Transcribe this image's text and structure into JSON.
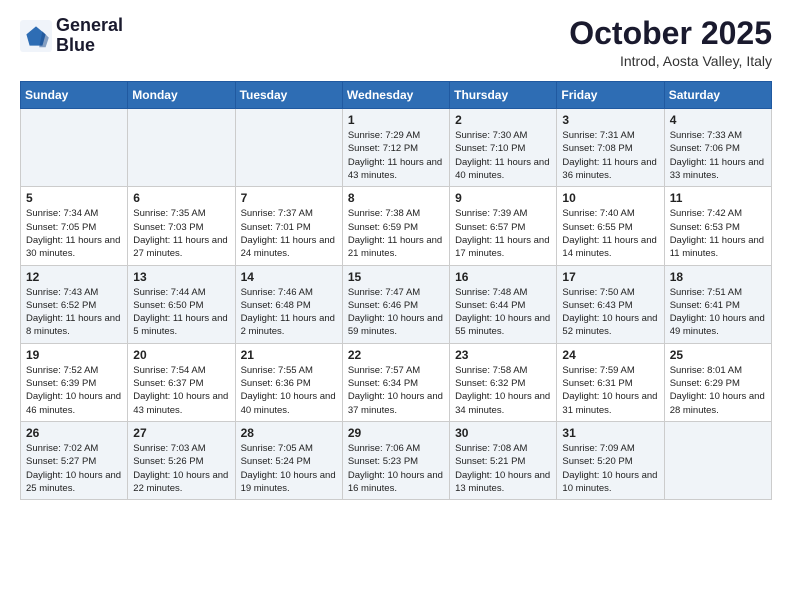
{
  "logo": {
    "line1": "General",
    "line2": "Blue"
  },
  "title": "October 2025",
  "location": "Introd, Aosta Valley, Italy",
  "days_of_week": [
    "Sunday",
    "Monday",
    "Tuesday",
    "Wednesday",
    "Thursday",
    "Friday",
    "Saturday"
  ],
  "weeks": [
    [
      {
        "day": "",
        "sunrise": "",
        "sunset": "",
        "daylight": ""
      },
      {
        "day": "",
        "sunrise": "",
        "sunset": "",
        "daylight": ""
      },
      {
        "day": "",
        "sunrise": "",
        "sunset": "",
        "daylight": ""
      },
      {
        "day": "1",
        "sunrise": "Sunrise: 7:29 AM",
        "sunset": "Sunset: 7:12 PM",
        "daylight": "Daylight: 11 hours and 43 minutes."
      },
      {
        "day": "2",
        "sunrise": "Sunrise: 7:30 AM",
        "sunset": "Sunset: 7:10 PM",
        "daylight": "Daylight: 11 hours and 40 minutes."
      },
      {
        "day": "3",
        "sunrise": "Sunrise: 7:31 AM",
        "sunset": "Sunset: 7:08 PM",
        "daylight": "Daylight: 11 hours and 36 minutes."
      },
      {
        "day": "4",
        "sunrise": "Sunrise: 7:33 AM",
        "sunset": "Sunset: 7:06 PM",
        "daylight": "Daylight: 11 hours and 33 minutes."
      }
    ],
    [
      {
        "day": "5",
        "sunrise": "Sunrise: 7:34 AM",
        "sunset": "Sunset: 7:05 PM",
        "daylight": "Daylight: 11 hours and 30 minutes."
      },
      {
        "day": "6",
        "sunrise": "Sunrise: 7:35 AM",
        "sunset": "Sunset: 7:03 PM",
        "daylight": "Daylight: 11 hours and 27 minutes."
      },
      {
        "day": "7",
        "sunrise": "Sunrise: 7:37 AM",
        "sunset": "Sunset: 7:01 PM",
        "daylight": "Daylight: 11 hours and 24 minutes."
      },
      {
        "day": "8",
        "sunrise": "Sunrise: 7:38 AM",
        "sunset": "Sunset: 6:59 PM",
        "daylight": "Daylight: 11 hours and 21 minutes."
      },
      {
        "day": "9",
        "sunrise": "Sunrise: 7:39 AM",
        "sunset": "Sunset: 6:57 PM",
        "daylight": "Daylight: 11 hours and 17 minutes."
      },
      {
        "day": "10",
        "sunrise": "Sunrise: 7:40 AM",
        "sunset": "Sunset: 6:55 PM",
        "daylight": "Daylight: 11 hours and 14 minutes."
      },
      {
        "day": "11",
        "sunrise": "Sunrise: 7:42 AM",
        "sunset": "Sunset: 6:53 PM",
        "daylight": "Daylight: 11 hours and 11 minutes."
      }
    ],
    [
      {
        "day": "12",
        "sunrise": "Sunrise: 7:43 AM",
        "sunset": "Sunset: 6:52 PM",
        "daylight": "Daylight: 11 hours and 8 minutes."
      },
      {
        "day": "13",
        "sunrise": "Sunrise: 7:44 AM",
        "sunset": "Sunset: 6:50 PM",
        "daylight": "Daylight: 11 hours and 5 minutes."
      },
      {
        "day": "14",
        "sunrise": "Sunrise: 7:46 AM",
        "sunset": "Sunset: 6:48 PM",
        "daylight": "Daylight: 11 hours and 2 minutes."
      },
      {
        "day": "15",
        "sunrise": "Sunrise: 7:47 AM",
        "sunset": "Sunset: 6:46 PM",
        "daylight": "Daylight: 10 hours and 59 minutes."
      },
      {
        "day": "16",
        "sunrise": "Sunrise: 7:48 AM",
        "sunset": "Sunset: 6:44 PM",
        "daylight": "Daylight: 10 hours and 55 minutes."
      },
      {
        "day": "17",
        "sunrise": "Sunrise: 7:50 AM",
        "sunset": "Sunset: 6:43 PM",
        "daylight": "Daylight: 10 hours and 52 minutes."
      },
      {
        "day": "18",
        "sunrise": "Sunrise: 7:51 AM",
        "sunset": "Sunset: 6:41 PM",
        "daylight": "Daylight: 10 hours and 49 minutes."
      }
    ],
    [
      {
        "day": "19",
        "sunrise": "Sunrise: 7:52 AM",
        "sunset": "Sunset: 6:39 PM",
        "daylight": "Daylight: 10 hours and 46 minutes."
      },
      {
        "day": "20",
        "sunrise": "Sunrise: 7:54 AM",
        "sunset": "Sunset: 6:37 PM",
        "daylight": "Daylight: 10 hours and 43 minutes."
      },
      {
        "day": "21",
        "sunrise": "Sunrise: 7:55 AM",
        "sunset": "Sunset: 6:36 PM",
        "daylight": "Daylight: 10 hours and 40 minutes."
      },
      {
        "day": "22",
        "sunrise": "Sunrise: 7:57 AM",
        "sunset": "Sunset: 6:34 PM",
        "daylight": "Daylight: 10 hours and 37 minutes."
      },
      {
        "day": "23",
        "sunrise": "Sunrise: 7:58 AM",
        "sunset": "Sunset: 6:32 PM",
        "daylight": "Daylight: 10 hours and 34 minutes."
      },
      {
        "day": "24",
        "sunrise": "Sunrise: 7:59 AM",
        "sunset": "Sunset: 6:31 PM",
        "daylight": "Daylight: 10 hours and 31 minutes."
      },
      {
        "day": "25",
        "sunrise": "Sunrise: 8:01 AM",
        "sunset": "Sunset: 6:29 PM",
        "daylight": "Daylight: 10 hours and 28 minutes."
      }
    ],
    [
      {
        "day": "26",
        "sunrise": "Sunrise: 7:02 AM",
        "sunset": "Sunset: 5:27 PM",
        "daylight": "Daylight: 10 hours and 25 minutes."
      },
      {
        "day": "27",
        "sunrise": "Sunrise: 7:03 AM",
        "sunset": "Sunset: 5:26 PM",
        "daylight": "Daylight: 10 hours and 22 minutes."
      },
      {
        "day": "28",
        "sunrise": "Sunrise: 7:05 AM",
        "sunset": "Sunset: 5:24 PM",
        "daylight": "Daylight: 10 hours and 19 minutes."
      },
      {
        "day": "29",
        "sunrise": "Sunrise: 7:06 AM",
        "sunset": "Sunset: 5:23 PM",
        "daylight": "Daylight: 10 hours and 16 minutes."
      },
      {
        "day": "30",
        "sunrise": "Sunrise: 7:08 AM",
        "sunset": "Sunset: 5:21 PM",
        "daylight": "Daylight: 10 hours and 13 minutes."
      },
      {
        "day": "31",
        "sunrise": "Sunrise: 7:09 AM",
        "sunset": "Sunset: 5:20 PM",
        "daylight": "Daylight: 10 hours and 10 minutes."
      },
      {
        "day": "",
        "sunrise": "",
        "sunset": "",
        "daylight": ""
      }
    ]
  ]
}
